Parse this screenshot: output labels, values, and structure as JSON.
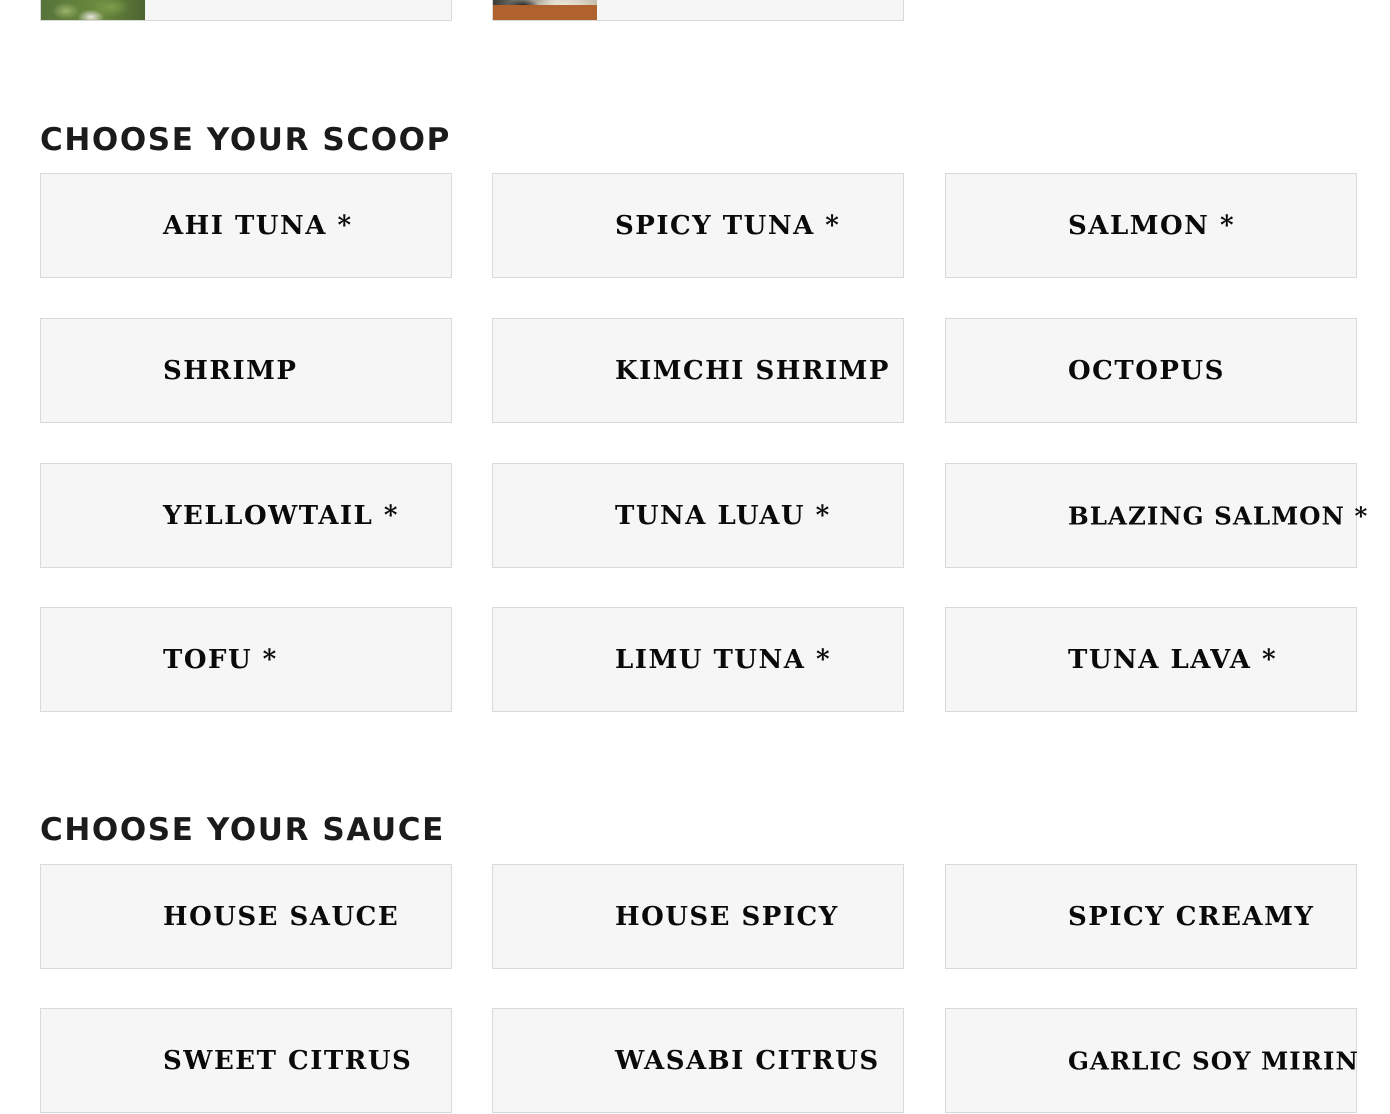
{
  "scoop": {
    "title": "CHOOSE YOUR SCOOP",
    "items": [
      {
        "label": "AHI TUNA *"
      },
      {
        "label": "SPICY TUNA *"
      },
      {
        "label": "SALMON *"
      },
      {
        "label": "SHRIMP"
      },
      {
        "label": "KIMCHI SHRIMP"
      },
      {
        "label": "OCTOPUS"
      },
      {
        "label": "YELLOWTAIL *"
      },
      {
        "label": "TUNA LUAU *"
      },
      {
        "label": "BLAZING SALMON *"
      },
      {
        "label": "TOFU *"
      },
      {
        "label": "LIMU TUNA *"
      },
      {
        "label": "TUNA LAVA *"
      }
    ]
  },
  "sauce": {
    "title": "CHOOSE YOUR SAUCE",
    "items": [
      {
        "label": "HOUSE SAUCE"
      },
      {
        "label": "HOUSE SPICY"
      },
      {
        "label": "SPICY CREAMY"
      },
      {
        "label": "SWEET CITRUS"
      },
      {
        "label": "WASABI CITRUS"
      },
      {
        "label": "GARLIC SOY MIRIN"
      }
    ]
  }
}
